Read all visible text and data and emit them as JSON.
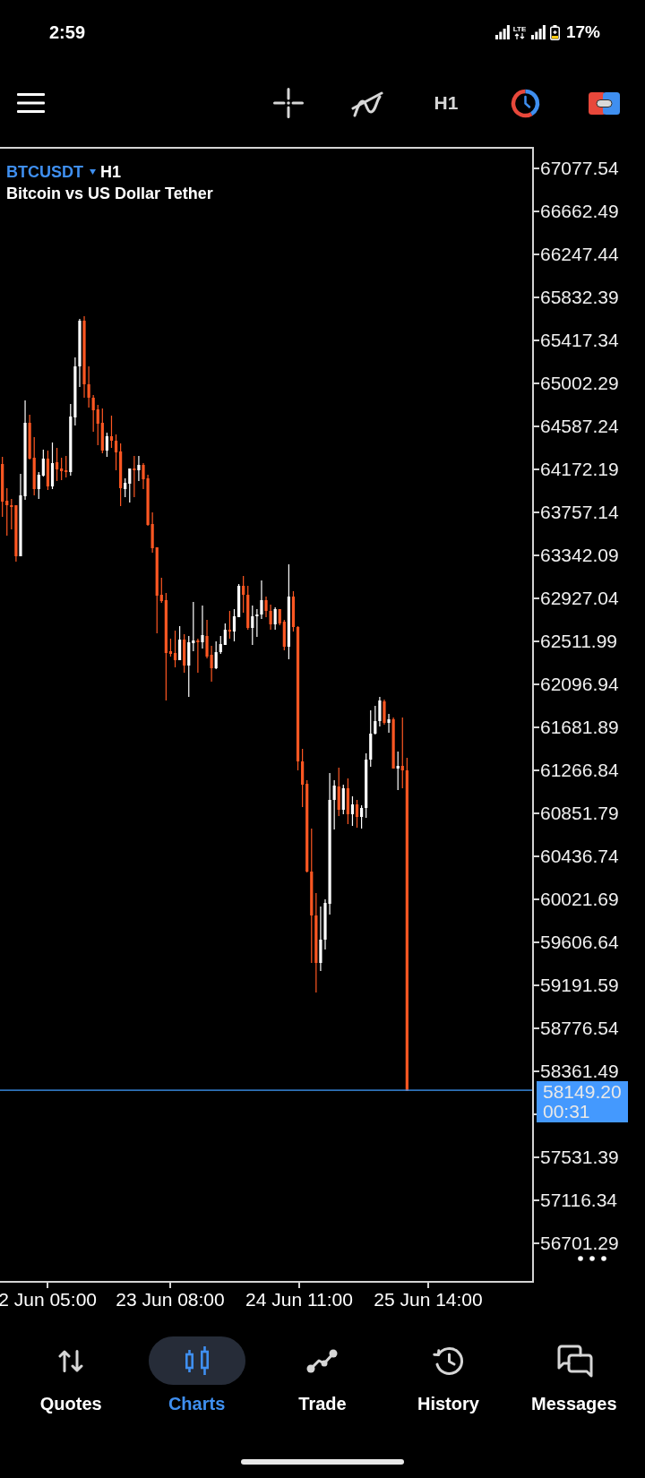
{
  "status_bar": {
    "time": "2:59",
    "network": "LTE",
    "battery": "17%"
  },
  "toolbar": {
    "timeframe": "H1"
  },
  "chart": {
    "symbol": "BTCUSDT",
    "timeframe": "H1",
    "description": "Bitcoin vs US Dollar Tether"
  },
  "price_axis": [
    {
      "kind": "label",
      "text": "67077.54"
    },
    {
      "kind": "label",
      "text": "66662.49"
    },
    {
      "kind": "label",
      "text": "66247.44"
    },
    {
      "kind": "label",
      "text": "65832.39"
    },
    {
      "kind": "label",
      "text": "65417.34"
    },
    {
      "kind": "label",
      "text": "65002.29"
    },
    {
      "kind": "label",
      "text": "64587.24"
    },
    {
      "kind": "label",
      "text": "64172.19"
    },
    {
      "kind": "label",
      "text": "63757.14"
    },
    {
      "kind": "label",
      "text": "63342.09"
    },
    {
      "kind": "label",
      "text": "62927.04"
    },
    {
      "kind": "label",
      "text": "62511.99"
    },
    {
      "kind": "label",
      "text": "62096.94"
    },
    {
      "kind": "label",
      "text": "61681.89"
    },
    {
      "kind": "label",
      "text": "61266.84"
    },
    {
      "kind": "label",
      "text": "60851.79"
    },
    {
      "kind": "label",
      "text": "60436.74"
    },
    {
      "kind": "label",
      "text": "60021.69"
    },
    {
      "kind": "label",
      "text": "59606.64"
    },
    {
      "kind": "label",
      "text": "59191.59"
    },
    {
      "kind": "label",
      "text": "58776.54"
    },
    {
      "kind": "label",
      "text": "58361.49"
    },
    {
      "kind": "current_price",
      "price": "58149.20",
      "countdown": "00:31"
    },
    {
      "kind": "label",
      "text": "57531.39"
    },
    {
      "kind": "label",
      "text": "57116.34"
    },
    {
      "kind": "label",
      "text": "56701.29"
    }
  ],
  "time_axis": [
    "2 Jun 05:00",
    "23 Jun 08:00",
    "24 Jun 11:00",
    "25 Jun 14:00"
  ],
  "nav": [
    {
      "label": "Quotes",
      "selected": false
    },
    {
      "label": "Charts",
      "selected": true
    },
    {
      "label": "Trade",
      "selected": false
    },
    {
      "label": "History",
      "selected": false
    },
    {
      "label": "Messages",
      "selected": false
    }
  ]
}
